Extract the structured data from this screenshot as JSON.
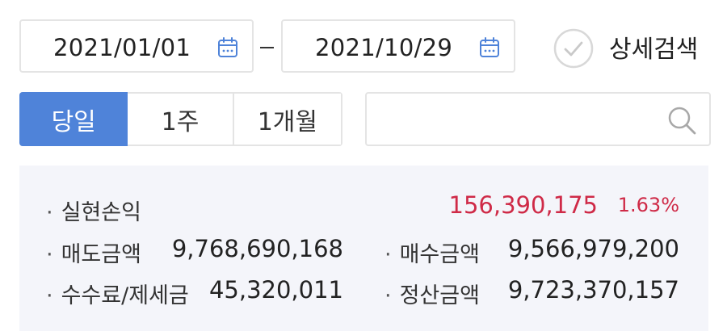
{
  "date_range": {
    "start": "2021/01/01",
    "end": "2021/10/29",
    "separator": "-"
  },
  "detail_search": {
    "label": "상세검색",
    "checked": false
  },
  "period_tabs": [
    {
      "label": "당일",
      "active": true
    },
    {
      "label": "1주",
      "active": false
    },
    {
      "label": "1개월",
      "active": false
    }
  ],
  "search": {
    "value": "",
    "placeholder": ""
  },
  "summary": {
    "bullet": "·",
    "profit_label": "실현손익",
    "profit_value": "156,390,175",
    "profit_rate": "1.63%",
    "sell_label": "매도금액",
    "sell_value": "9,768,690,168",
    "buy_label": "매수금액",
    "buy_value": "9,566,979,200",
    "fee_label": "수수료/제세금",
    "fee_value": "45,320,011",
    "settle_label": "정산금액",
    "settle_value": "9,723,370,157"
  },
  "colors": {
    "accent": "#4f83d9",
    "profit": "#cf2a47",
    "panel_bg": "#f4f5fa",
    "border": "#e4e4e4"
  }
}
